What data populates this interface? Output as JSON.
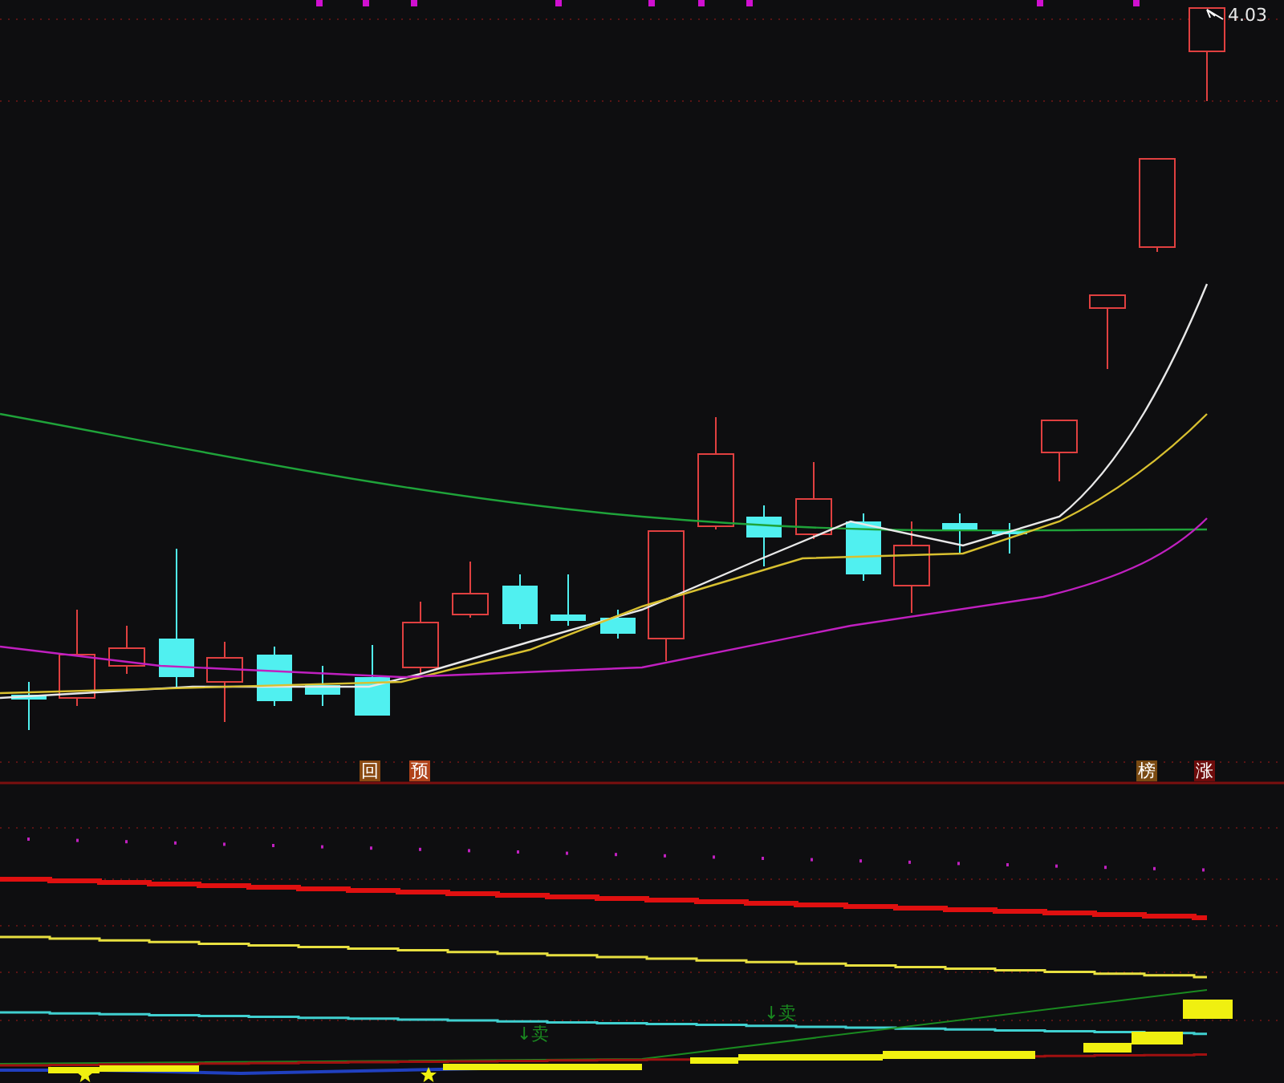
{
  "price_chart": {
    "high_label": "4.03",
    "signals": [
      {
        "text": "回",
        "color": "#8a4a12"
      },
      {
        "text": "预",
        "color": "#b0431a"
      },
      {
        "text": "榜",
        "color": "#7a4a12"
      },
      {
        "text": "涨",
        "color": "#6e0c0c"
      }
    ]
  },
  "indicator_panel": {
    "sell_signals": [
      {
        "text": "↓卖"
      },
      {
        "text": "↓卖"
      }
    ]
  }
}
